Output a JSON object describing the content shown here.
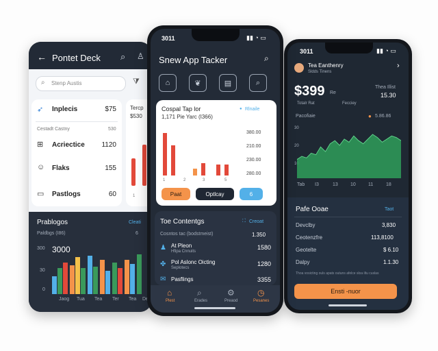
{
  "left": {
    "title": "Pontet Deck",
    "search_placeholder": "Stenp Austis",
    "section_label": "Cestadt Castny",
    "section_count": "530",
    "items": [
      {
        "label": "Inplecis",
        "value": "$75"
      },
      {
        "label": "Acriectice",
        "value": "1120"
      },
      {
        "label": "Flaks",
        "value": "155"
      },
      {
        "label": "Pastlogs",
        "value": "60"
      }
    ],
    "peek_title": "Tercp",
    "peek_value": "$530",
    "chart": {
      "title": "Prablogos",
      "link": "Cleati",
      "sub": "Paldbgs (I86)",
      "sub_val": "6",
      "big_value": "3000",
      "yticks": [
        "300",
        "30",
        "0"
      ],
      "xlabels": [
        "Jaog",
        "Tua",
        "Tea",
        "Ter",
        "Tea",
        "Deo"
      ]
    }
  },
  "middle": {
    "time": "3011",
    "title": "Snew App Tacker",
    "card": {
      "title": "Cospal Tap lor",
      "subtitle": "1,171 Pie Yarc (I366)",
      "link": "Rlnaile",
      "yticks": [
        "380.00",
        "210.00",
        "230.00",
        "280.00"
      ],
      "xlabels": [
        "1",
        "2",
        "3",
        "5"
      ],
      "btn1": "Paat",
      "btn2": "Optlcay",
      "btn3": "6"
    },
    "contents": {
      "title": "Toe Contentgs",
      "link": "Creoat",
      "sub": "Cosntos tac (bodstmeist)",
      "sub_val": "1.350",
      "items": [
        {
          "label": "At Pleon",
          "sub": "Hfipa Cnnuits",
          "value": "1580"
        },
        {
          "label": "Pol Aslonc Oicting",
          "sub": "Seplotecs",
          "value": "1280"
        },
        {
          "label": "Pasflings",
          "sub": "",
          "value": "3355"
        }
      ]
    },
    "nav": [
      "Plest",
      "Erades",
      "Preaod",
      "Pesanes"
    ]
  },
  "right": {
    "time": "3011",
    "user_name": "Tea Eanthenry",
    "user_sub": "Sldds Tinens",
    "amount": "$399",
    "amount_suffix": "Re",
    "side_label": "Thea Illist",
    "side_value": "15.30",
    "legend": [
      "Totalr Rat",
      "Fecciey"
    ],
    "series_label": "Pacofiaie",
    "series_value": "5.86.86",
    "yticks": [
      "30",
      "20",
      "10"
    ],
    "xlabels": [
      "Tab",
      "I3",
      "13",
      "10",
      "11",
      "18"
    ],
    "chart_data": {
      "type": "area",
      "x": [
        1,
        2,
        3,
        4,
        5,
        6,
        7,
        8,
        9,
        10,
        11,
        12,
        13,
        14,
        15,
        16,
        17,
        18,
        19,
        20,
        21,
        22,
        23
      ],
      "values": [
        12,
        14,
        13,
        16,
        15,
        20,
        17,
        22,
        24,
        21,
        25,
        23,
        27,
        24,
        22,
        25,
        28,
        26,
        23,
        25,
        27,
        26,
        24
      ],
      "ylim": [
        0,
        35
      ]
    },
    "color_accent": "#2f9e5b",
    "table": {
      "title": "Pafe Ooae",
      "link": "Taot",
      "rows": [
        {
          "label": "Devclby",
          "value": "3,830"
        },
        {
          "label": "Ceotenzfre",
          "value": "113,8100"
        },
        {
          "label": "Geotelte",
          "value": "$ 6.10"
        },
        {
          "label": "Dalpy",
          "value": "1.1.30"
        }
      ]
    },
    "note": "Thoa vosicting ouls apats outuns afelce sloa iltu cuslas",
    "cta": "Ensti ‑nuor"
  },
  "colors": {
    "orange": "#f4934a",
    "blue": "#53b0e8",
    "red": "#e2493a",
    "green": "#3a9a5b"
  }
}
